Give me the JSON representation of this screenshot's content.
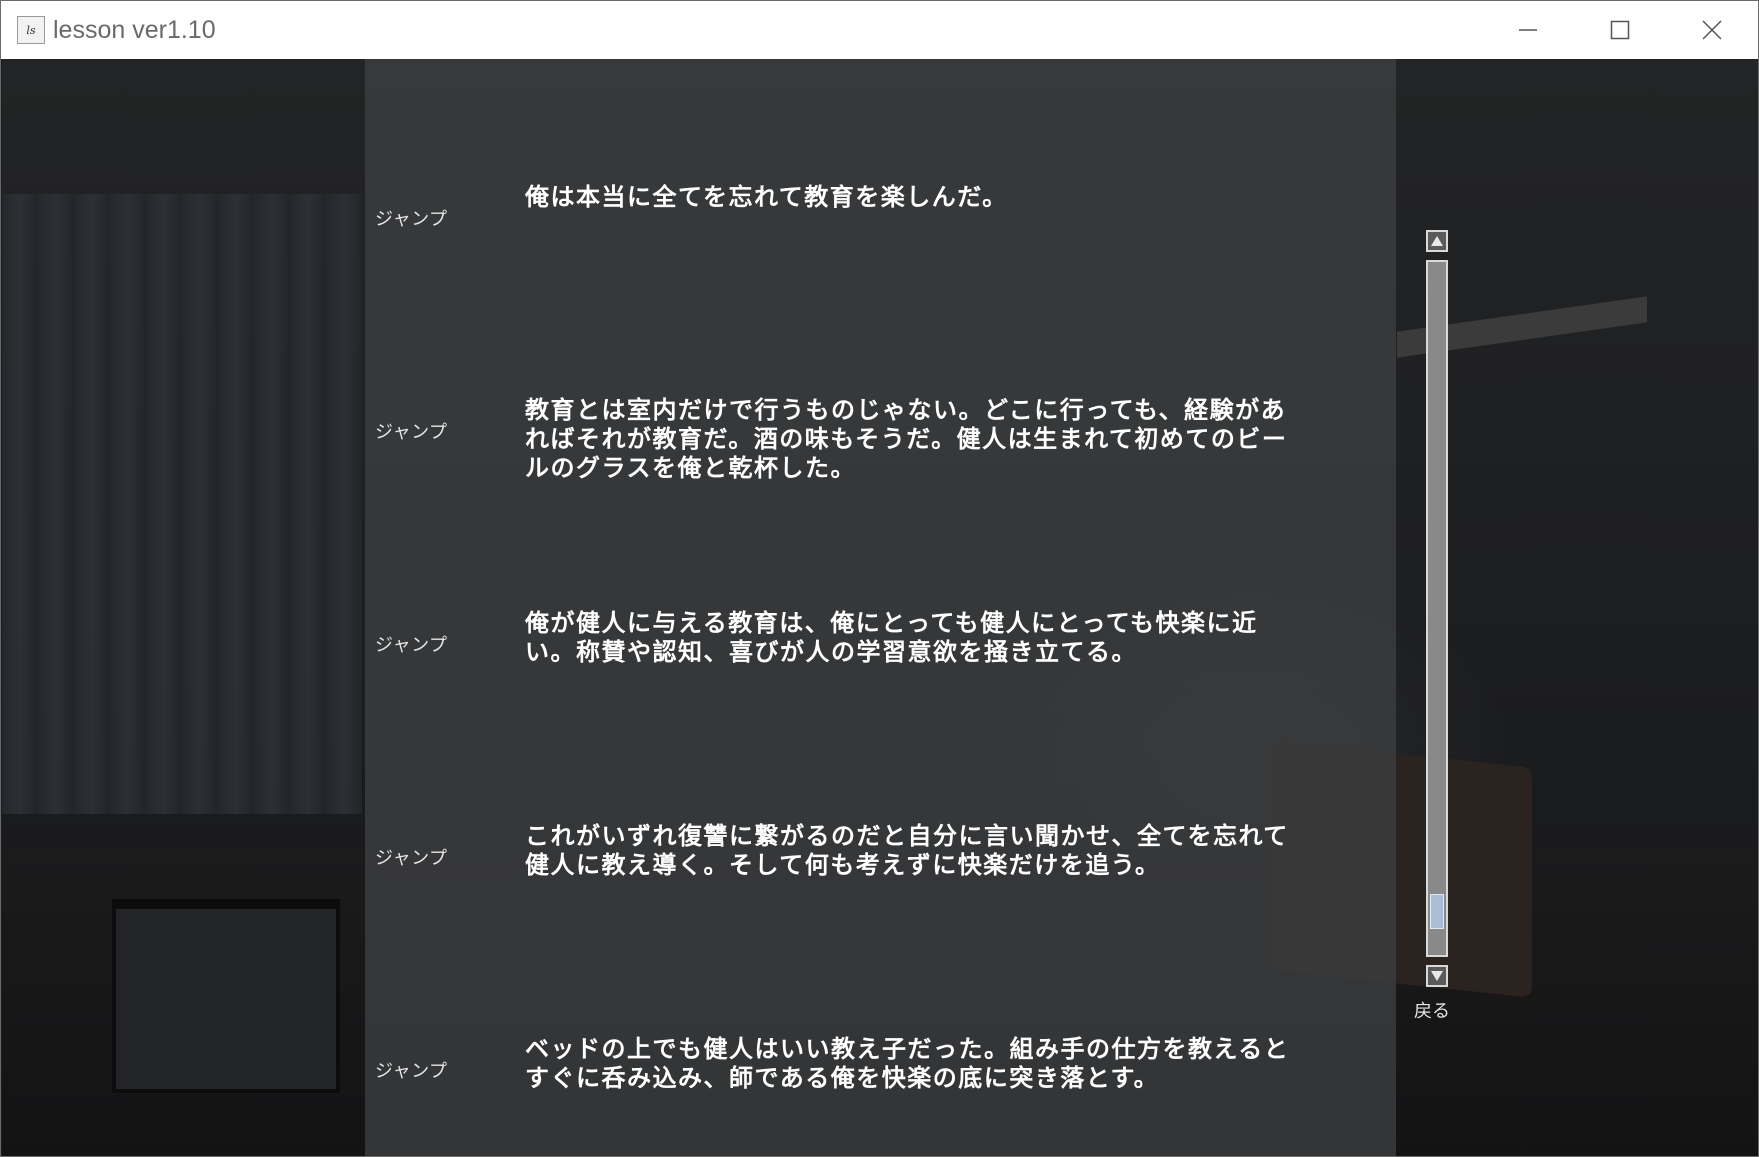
{
  "window": {
    "title": "lesson ver1.10",
    "icon": "app-icon",
    "controls": [
      "minimize-icon",
      "maximize-icon",
      "close-icon"
    ]
  },
  "backlog": {
    "entries": [
      {
        "jump_label": "ジャンプ",
        "text": "俺は本当に全てを忘れて教育を楽しんだ。"
      },
      {
        "jump_label": "ジャンプ",
        "text": "教育とは室内だけで行うものじゃない。どこに行っても、経験があればそれが教育だ。酒の味もそうだ。健人は生まれて初めてのビールのグラスを俺と乾杯した。"
      },
      {
        "jump_label": "ジャンプ",
        "text": "俺が健人に与える教育は、俺にとっても健人にとっても快楽に近い。称賛や認知、喜びが人の学習意欲を掻き立てる。"
      },
      {
        "jump_label": "ジャンプ",
        "text": "これがいずれ復讐に繋がるのだと自分に言い聞かせ、全てを忘れて健人に教え導く。そして何も考えずに快楽だけを追う。"
      },
      {
        "jump_label": "ジャンプ",
        "text": "ベッドの上でも健人はいい教え子だった。組み手の仕方を教えるとすぐに呑み込み、師である俺を快楽の底に突き落とす。"
      }
    ],
    "back_label": "戻る"
  },
  "scrollbar": {
    "position_fraction": 0.96,
    "visible_fraction": 0.05,
    "up_icon": "triangle-up-icon",
    "down_icon": "triangle-down-icon"
  }
}
